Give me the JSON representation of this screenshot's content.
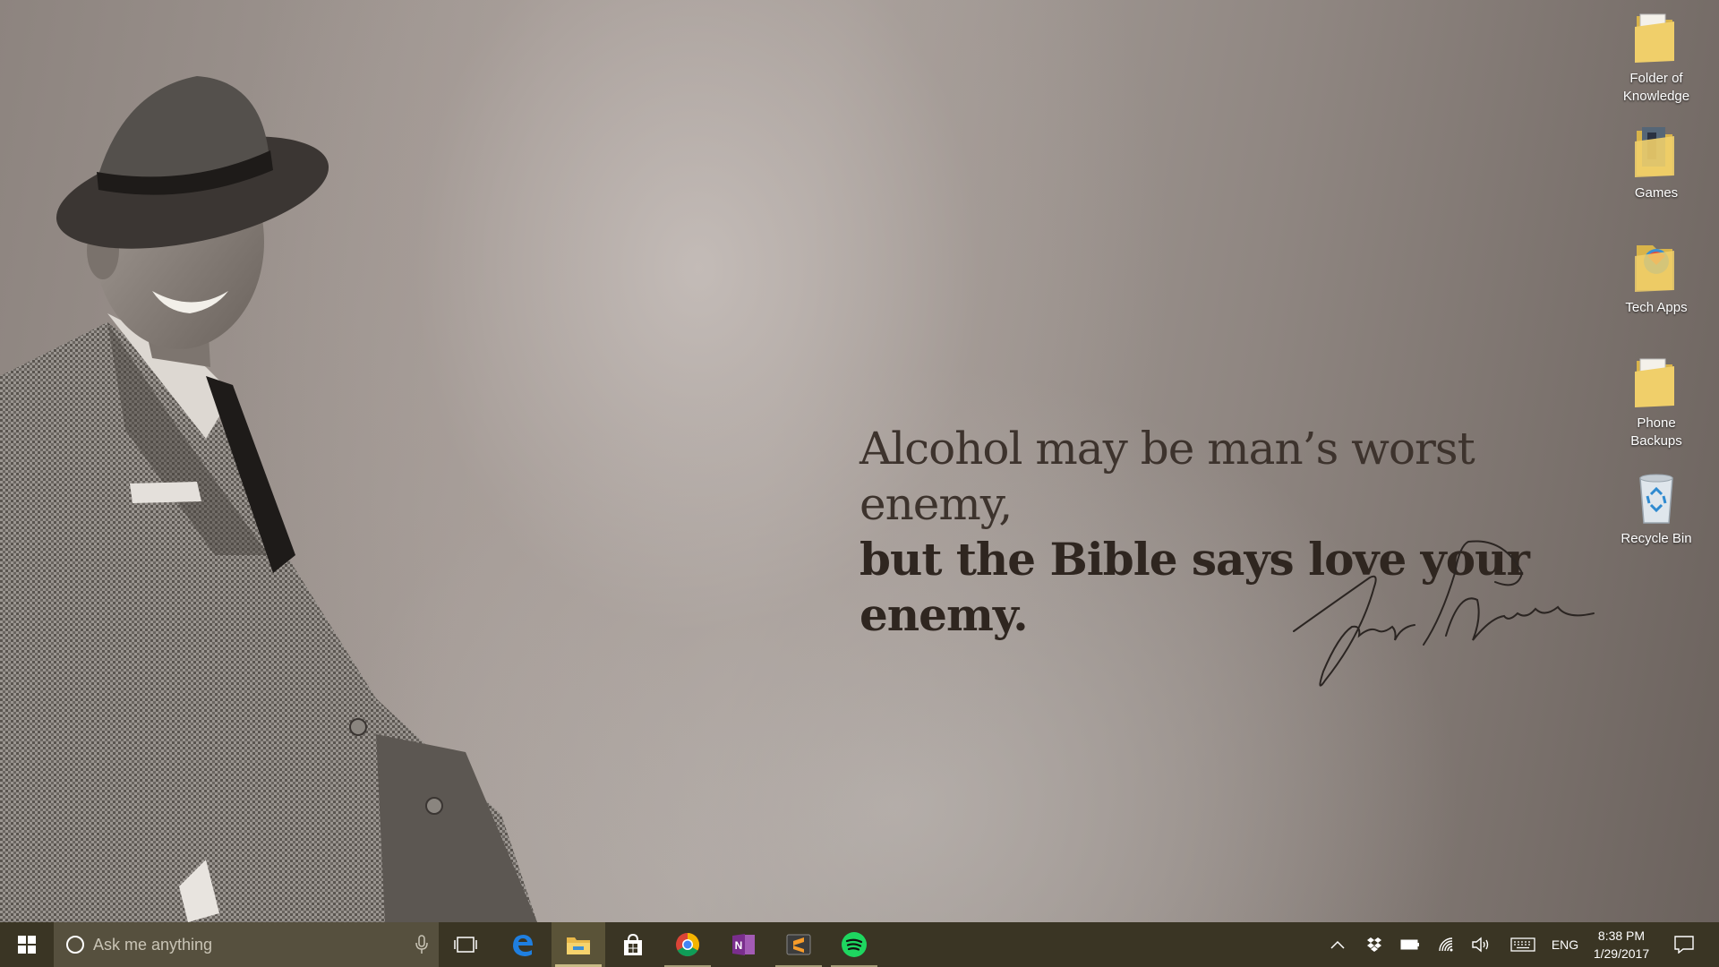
{
  "wallpaper": {
    "quote_line1": "Alcohol may be man’s worst enemy,",
    "quote_line2": "but the Bible says love your enemy.",
    "signature": "Frank Sinatra"
  },
  "desktop_icons": [
    {
      "label_line1": "Folder of",
      "label_line2": "Knowledge",
      "icon": "folder-icon"
    },
    {
      "label_line1": "Games",
      "label_line2": "",
      "icon": "folder-icon"
    },
    {
      "label_line1": "Tech Apps",
      "label_line2": "",
      "icon": "folder-icon"
    },
    {
      "label_line1": "Phone",
      "label_line2": "Backups",
      "icon": "folder-icon"
    },
    {
      "label_line1": "Recycle Bin",
      "label_line2": "",
      "icon": "recycle-bin-icon"
    }
  ],
  "taskbar": {
    "search_placeholder": "Ask me anything",
    "apps": [
      "Task View",
      "Microsoft Edge",
      "File Explorer",
      "Windows Store",
      "Google Chrome",
      "OneNote",
      "Sublime Text",
      "Spotify"
    ],
    "tray": {
      "language": "ENG",
      "time": "8:38 PM",
      "date": "1/29/2017"
    }
  },
  "colors": {
    "taskbar": "#3a3524",
    "search_box": "#56503e",
    "accent": "#c8bb86"
  }
}
